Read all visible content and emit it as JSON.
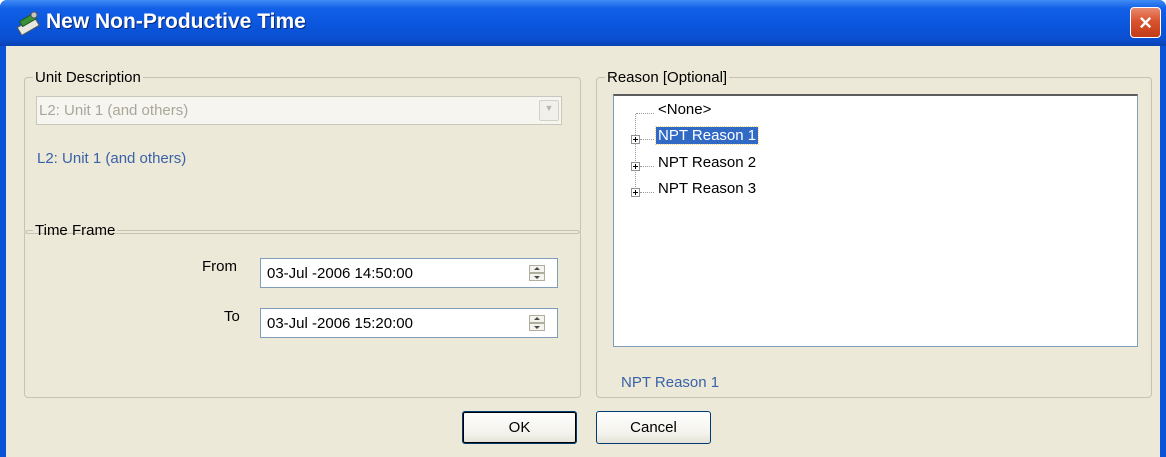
{
  "window": {
    "title": "New Non-Productive Time",
    "close_glyph": "×",
    "icon": "app-icon"
  },
  "unit_description": {
    "legend": "Unit Description",
    "combo_value": "L2: Unit 1 (and others)",
    "selected_text": "L2: Unit 1 (and others)"
  },
  "time_frame": {
    "legend": "Time Frame",
    "from_label": "From",
    "from_value": "03-Jul -2006 14:50:00",
    "to_label": "To",
    "to_value": "03-Jul -2006 15:20:00"
  },
  "reason": {
    "legend": "Reason [Optional]",
    "tree": [
      {
        "label": "<None>",
        "expandable": false,
        "selected": false
      },
      {
        "label": "NPT Reason 1",
        "expandable": true,
        "selected": true
      },
      {
        "label": "NPT Reason 2",
        "expandable": true,
        "selected": false
      },
      {
        "label": "NPT Reason 3",
        "expandable": true,
        "selected": false
      }
    ],
    "selected_text": "NPT Reason 1"
  },
  "buttons": {
    "ok": "OK",
    "cancel": "Cancel"
  },
  "colors": {
    "titlebar": "#0a56dd",
    "client": "#ece9d8",
    "link": "#3a62a8",
    "selection": "#316ac5",
    "close": "#d9532e"
  }
}
